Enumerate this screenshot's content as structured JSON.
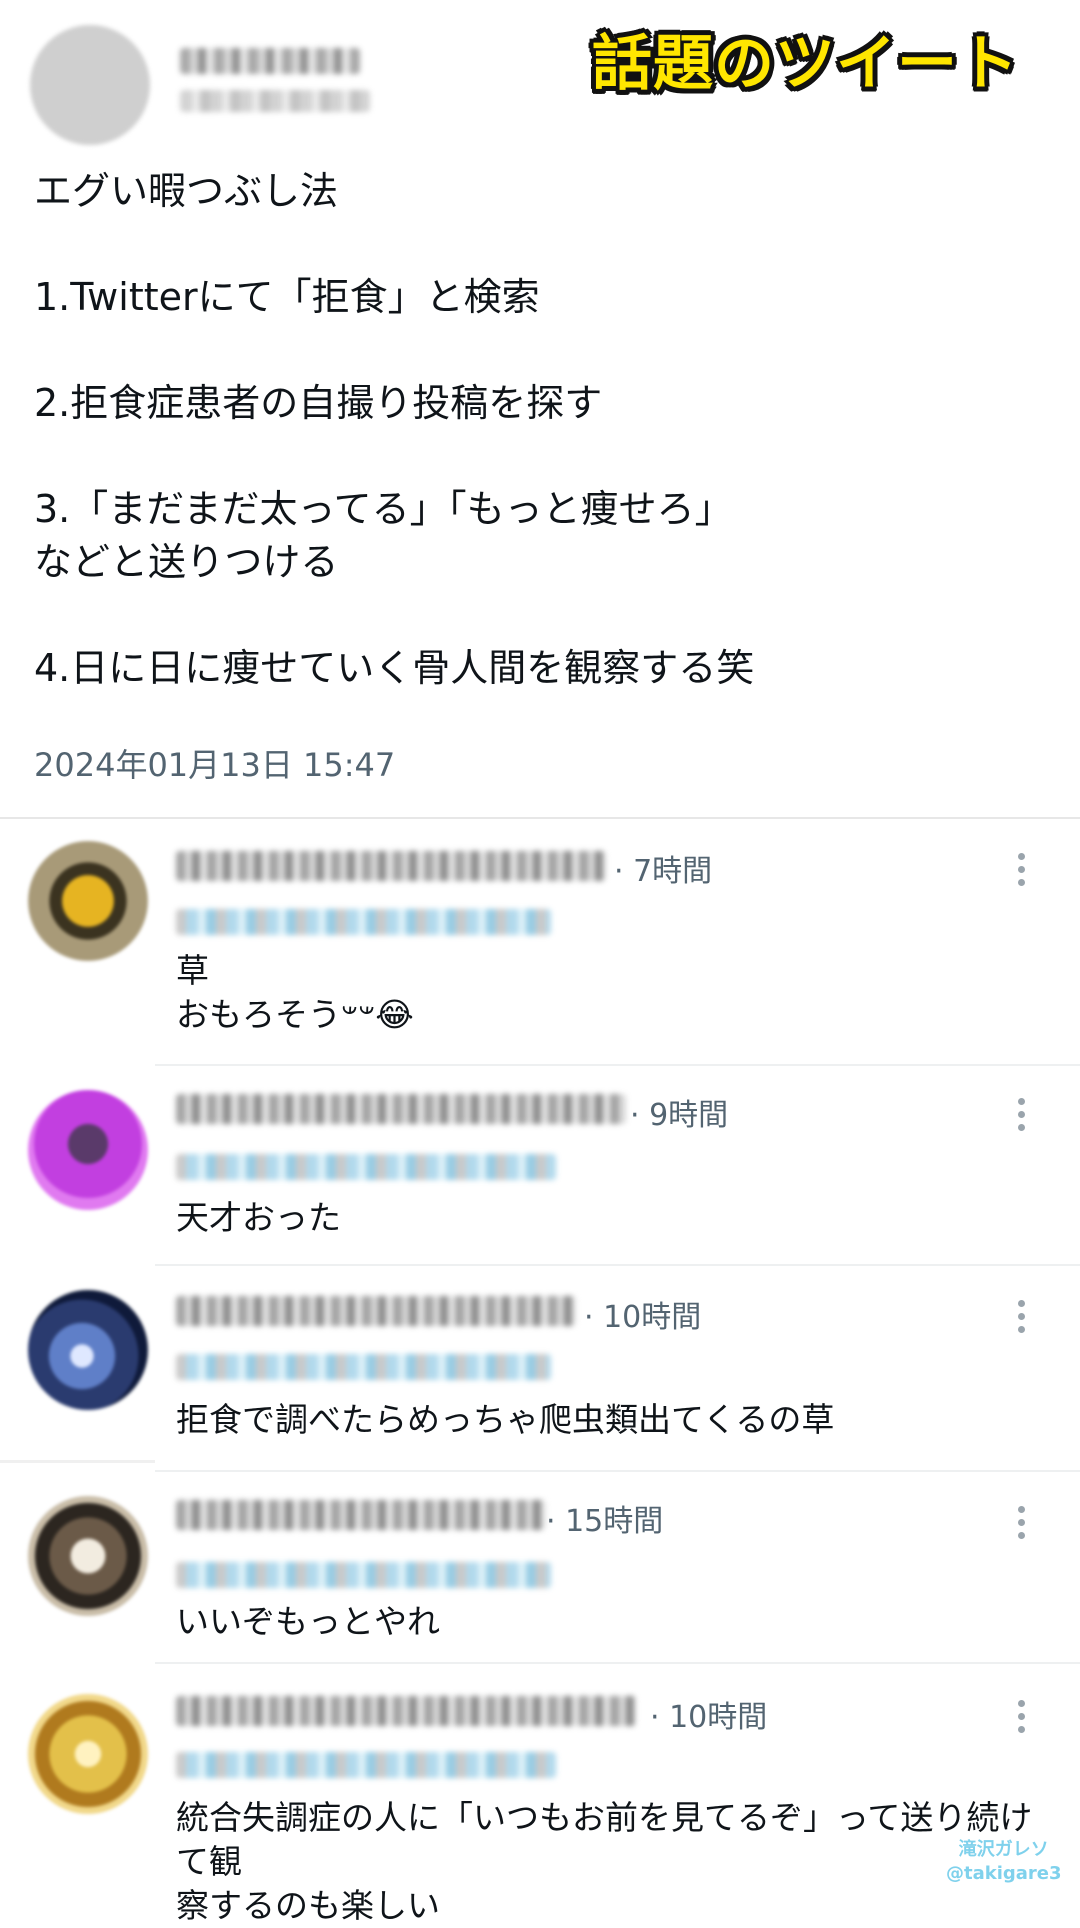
{
  "banner": "話題のツイート",
  "tweet": {
    "lines": [
      "エグい暇つぶし法",
      "",
      "1.Twitterにて「拒食」と検索",
      "",
      "2.拒食症患者の自撮り投稿を探す",
      "",
      "3.「まだまだ太ってる」「もっと痩せろ」",
      "などと送りつける",
      "",
      "4.日に日に痩せていく骨人間を観察する笑"
    ],
    "timestamp": "2024年01月13日 15:47"
  },
  "replies": [
    {
      "time": "· 7時間",
      "text": [
        "草",
        "おもろそう𐤔𐤔😂"
      ],
      "avatar_color": "#b8941f"
    },
    {
      "time": "· 9時間",
      "text": [
        "天才おった"
      ],
      "avatar_color": "#c23fe0"
    },
    {
      "time": "· 10時間",
      "text": [
        "拒食で調べたらめっちゃ爬虫類出てくるの草"
      ],
      "avatar_color": "#2f4f8f"
    },
    {
      "time": "· 15時間",
      "text": [
        "いいぞもっとやれ"
      ],
      "avatar_color": "#6b5a48"
    },
    {
      "time": "· 10時間",
      "text": [
        "統合失調症の人に「いつもお前を見てるぞ」って送り続けて観",
        "察するのも楽しい"
      ],
      "avatar_color": "#e3c04a"
    }
  ],
  "watermark": {
    "line1": "滝沢ガレソ",
    "line2": "@takigare3"
  }
}
